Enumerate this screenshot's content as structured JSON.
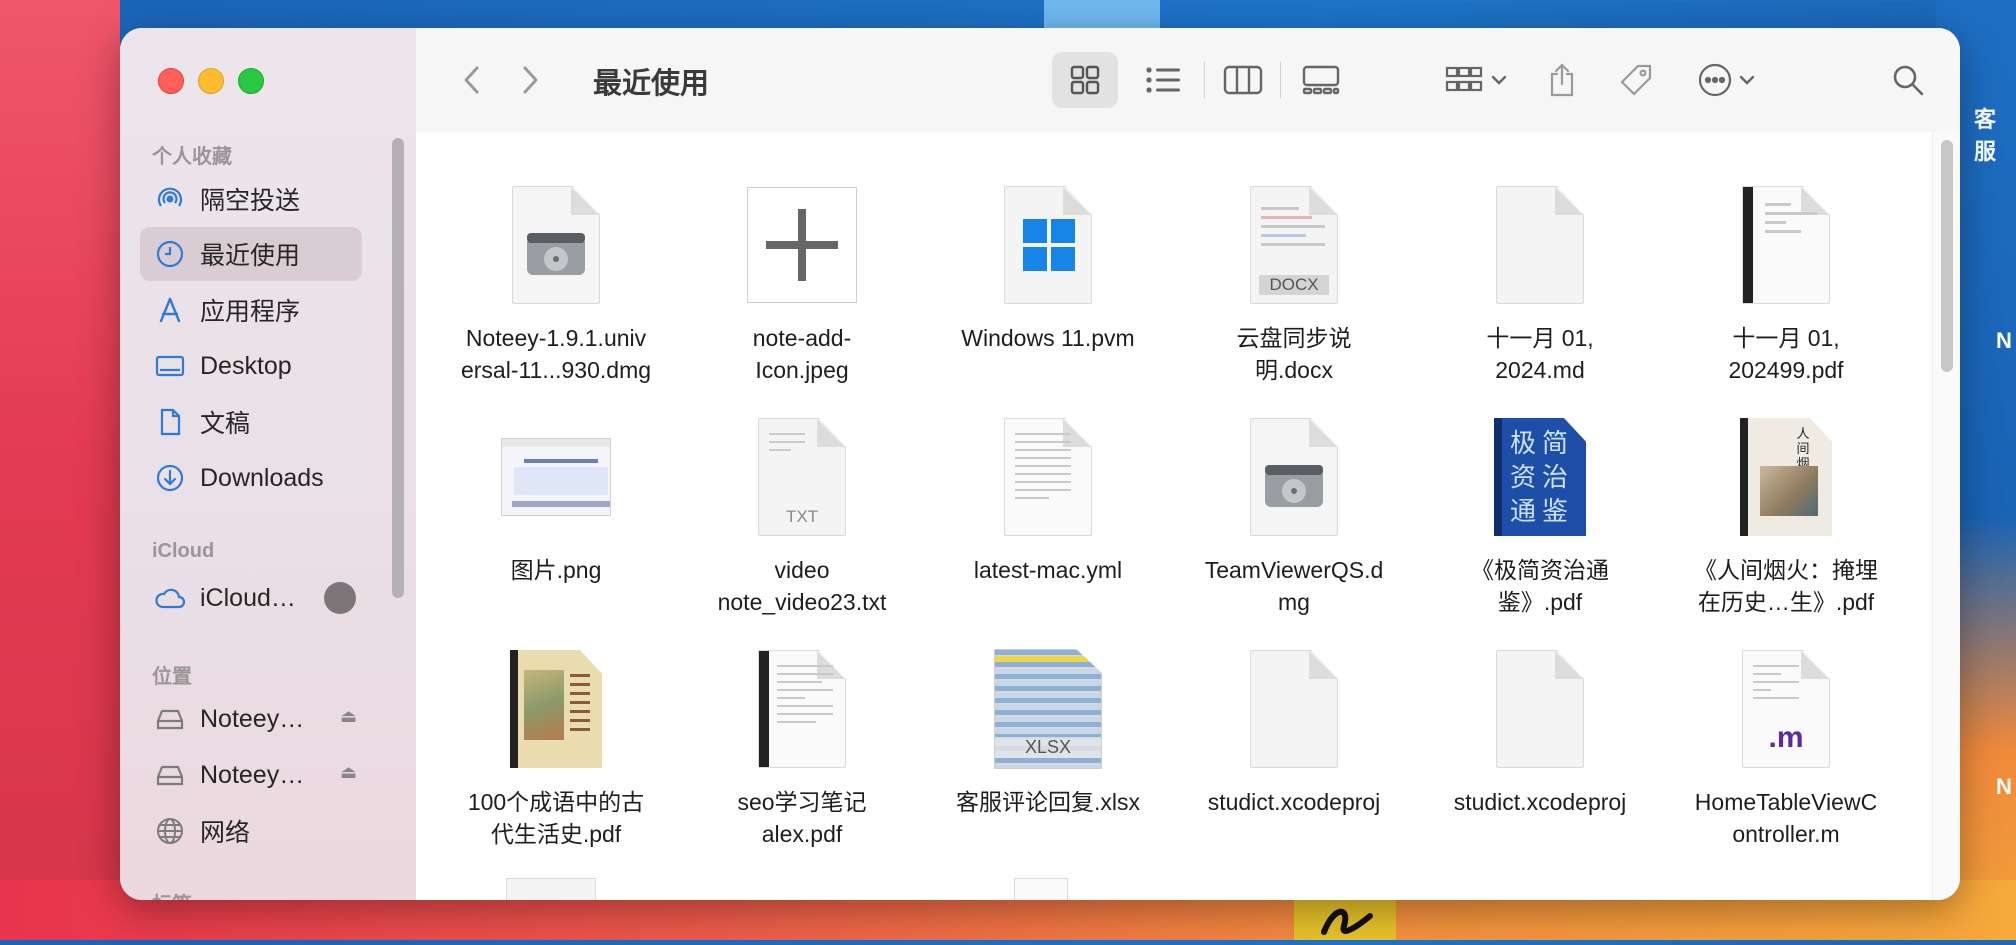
{
  "desktop": {
    "labels": [
      "客服",
      "N",
      "N"
    ]
  },
  "window": {
    "title": "最近使用"
  },
  "sidebar": {
    "sections": {
      "favorites": "个人收藏",
      "icloud": "iCloud",
      "locations": "位置",
      "tags": "标签"
    },
    "favorites": [
      {
        "label": "隔空投送",
        "icon": "airdrop-icon"
      },
      {
        "label": "最近使用",
        "icon": "clock-icon",
        "active": true
      },
      {
        "label": "应用程序",
        "icon": "applications-icon"
      },
      {
        "label": "Desktop",
        "icon": "desktop-icon"
      },
      {
        "label": "文稿",
        "icon": "document-icon"
      },
      {
        "label": "Downloads",
        "icon": "download-icon"
      }
    ],
    "icloud": [
      {
        "label": "iCloud…",
        "icon": "cloud-icon"
      }
    ],
    "locations": [
      {
        "label": "Noteey…",
        "icon": "drive-icon"
      },
      {
        "label": "Noteey…",
        "icon": "drive-icon"
      },
      {
        "label": "网络",
        "icon": "network-icon"
      }
    ]
  },
  "files": [
    {
      "name": "Noteey-1.9.1.universal-11...930.dmg",
      "display": [
        "Noteey-1.9.1.univ",
        "ersal-11...930.dmg"
      ],
      "kind": "disk-image"
    },
    {
      "name": "note-add-Icon.jpeg",
      "display": [
        "note-add-",
        "Icon.jpeg"
      ],
      "kind": "image-plus"
    },
    {
      "name": "Windows 11.pvm",
      "display": [
        "Windows 11.pvm"
      ],
      "kind": "windows"
    },
    {
      "name": "云盘同步说明.docx",
      "display": [
        "云盘同步说",
        "明.docx"
      ],
      "kind": "docx",
      "ext": "DOCX"
    },
    {
      "name": "十一月 01, 2024.md",
      "display": [
        "十一月 01,",
        "2024.md"
      ],
      "kind": "blank"
    },
    {
      "name": "十一月 01, 202499.pdf",
      "display": [
        "十一月 01,",
        "202499.pdf"
      ],
      "kind": "pdf"
    },
    {
      "name": "图片.png",
      "display": [
        "图片.png"
      ],
      "kind": "screenshot"
    },
    {
      "name": "video note_video23.txt",
      "display": [
        "video",
        "note_video23.txt"
      ],
      "kind": "txt",
      "ext": "TXT"
    },
    {
      "name": "latest-mac.yml",
      "display": [
        "latest-mac.yml"
      ],
      "kind": "text-lines"
    },
    {
      "name": "TeamViewerQS.dmg",
      "display": [
        "TeamViewerQS.d",
        "mg"
      ],
      "kind": "disk-image"
    },
    {
      "name": "《极简资治通鉴》.pdf",
      "display": [
        "《极简资治通",
        "鉴》.pdf"
      ],
      "kind": "book-blue",
      "cover": "极简资治通鉴"
    },
    {
      "name": "《人间烟火：掩埋在历史…生》.pdf",
      "display": [
        "《人间烟火：掩埋",
        "在历史…生》.pdf"
      ],
      "kind": "book-art",
      "cover": "人间烟火"
    },
    {
      "name": "100个成语中的古代生活史.pdf",
      "display": [
        "100个成语中的古",
        "代生活史.pdf"
      ],
      "kind": "book-old"
    },
    {
      "name": "seo学习笔记alex.pdf",
      "display": [
        "seo学习笔记",
        "alex.pdf"
      ],
      "kind": "pdf"
    },
    {
      "name": "客服评论回复.xlsx",
      "display": [
        "客服评论回复.xlsx"
      ],
      "kind": "xlsx",
      "ext": "XLSX"
    },
    {
      "name": "studict.xcodeproj",
      "display": [
        "studict.xcodeproj"
      ],
      "kind": "blank"
    },
    {
      "name": "studict.xcodeproj",
      "display": [
        "studict.xcodeproj"
      ],
      "kind": "blank"
    },
    {
      "name": "HomeTableViewController.m",
      "display": [
        "HomeTableViewC",
        "ontroller.m"
      ],
      "kind": "m-source",
      "ext": ".m"
    }
  ],
  "colors": {
    "accent": "#2f7ad8",
    "sidebar_active": "#d9cdd3"
  }
}
